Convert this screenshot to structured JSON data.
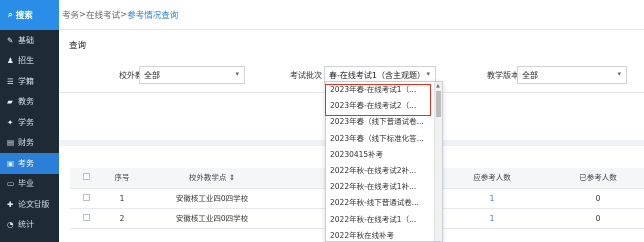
{
  "sidebar": {
    "search": "搜索",
    "items": [
      {
        "label": "基础",
        "icon": "pencil-icon"
      },
      {
        "label": "招生",
        "icon": "user-plus-icon"
      },
      {
        "label": "学籍",
        "icon": "list-icon"
      },
      {
        "label": "教务",
        "icon": "folder-icon"
      },
      {
        "label": "学务",
        "icon": "graduation-icon"
      },
      {
        "label": "财务",
        "icon": "money-icon"
      },
      {
        "label": "考务",
        "icon": "exam-icon"
      },
      {
        "label": "毕业",
        "icon": "certificate-icon"
      },
      {
        "label": "论文답版",
        "icon": "thesis-icon"
      },
      {
        "label": "统计",
        "icon": "chart-icon"
      }
    ],
    "active_index": 6
  },
  "breadcrumb": {
    "part1": "考务",
    "sep1": ">",
    "part2": "在线考试",
    "sep2": ">",
    "current": "参考情况查询"
  },
  "query": {
    "title": "查询",
    "campus_label": "校外教学点",
    "campus_value": "全部",
    "batch_label": "考试批次",
    "batch_value": "春-在线考试1（含主观题）",
    "version_label": "教学版本",
    "version_value": "全部"
  },
  "dropdown_options": [
    "2023年春-在线考试1（...",
    "2023年春-在线考试2（...",
    "2023年春（线下普通试卷...",
    "2023年春（线下标准化答...",
    "20230415补考",
    "2022年秋-在线考试2补...",
    "2022年秋-在线考试1补...",
    "2022年秋-线下普通试卷...",
    "2022年秋-在线考试1（...",
    "2022年秋在线补考"
  ],
  "table": {
    "headers": {
      "seq": "序号",
      "campus": "校外教学点 ⇕",
      "should": "应参考人数",
      "did": "已参考人数"
    },
    "rows": [
      {
        "seq": "1",
        "campus": "安徽核工业四0四学校",
        "should": "1",
        "did": "0"
      },
      {
        "seq": "2",
        "campus": "安徽核工业四0四学校",
        "should": "1",
        "did": "0"
      }
    ]
  },
  "colors": {
    "sidebar_bg": "#1e2a36",
    "active": "#2c7fd6",
    "link": "#2a7fd0",
    "highlight": "#e0321e"
  }
}
